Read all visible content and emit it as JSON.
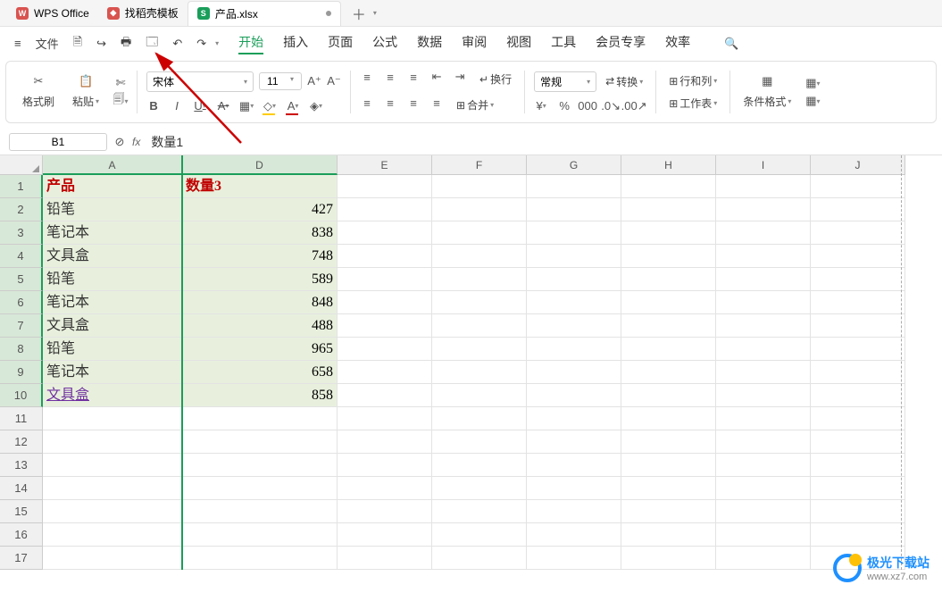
{
  "app": {
    "name": "WPS Office",
    "template_tab": "找稻壳模板",
    "file_tab": "产品.xlsx"
  },
  "quick": {
    "file": "文件"
  },
  "menu": {
    "start": "开始",
    "insert": "插入",
    "page": "页面",
    "formula": "公式",
    "data": "数据",
    "review": "审阅",
    "view": "视图",
    "tools": "工具",
    "member": "会员专享",
    "efficiency": "效率"
  },
  "ribbon": {
    "format_painter": "格式刷",
    "paste": "粘贴",
    "font_name": "宋体",
    "font_size": "11",
    "normal": "常规",
    "convert": "转换",
    "wrap": "换行",
    "merge": "合并",
    "rowcol": "行和列",
    "worksheet": "工作表",
    "cond_format": "条件格式"
  },
  "namebox": {
    "ref": "B1",
    "formula": "数量1"
  },
  "columns": [
    "A",
    "D",
    "E",
    "F",
    "G",
    "H",
    "I",
    "J"
  ],
  "rows": [
    1,
    2,
    3,
    4,
    5,
    6,
    7,
    8,
    9,
    10,
    11,
    12,
    13,
    14,
    15,
    16,
    17
  ],
  "data": {
    "headerA": "产品",
    "headerD": "数量3",
    "rowsA": [
      "铅笔",
      "笔记本",
      "文具盒",
      "铅笔",
      "笔记本",
      "文具盒",
      "铅笔",
      "笔记本",
      "文具盒"
    ],
    "rowsD": [
      427,
      838,
      748,
      589,
      848,
      488,
      965,
      658,
      858
    ]
  },
  "watermark": {
    "title": "极光下载站",
    "url": "www.xz7.com"
  },
  "colwidths": {
    "A": 156,
    "D": 174,
    "other": 106
  }
}
